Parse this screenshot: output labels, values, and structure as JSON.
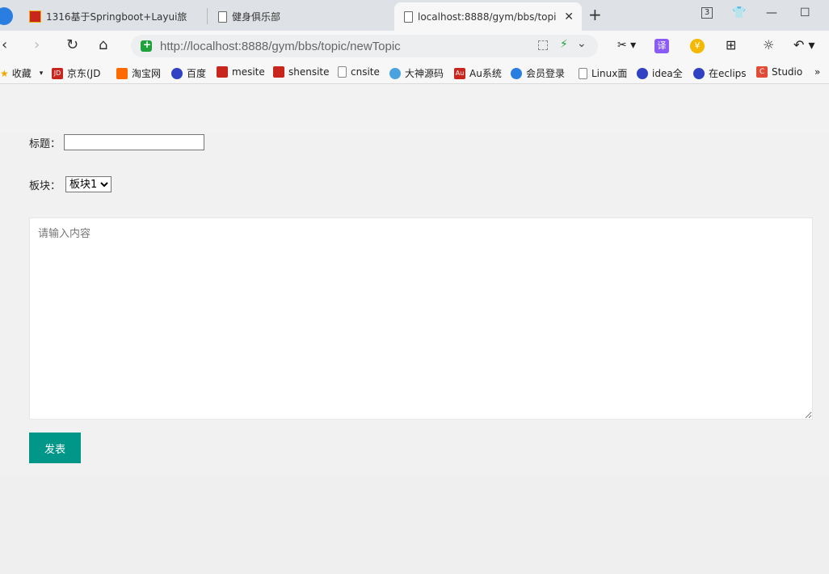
{
  "browser": {
    "tabs": [
      {
        "label": "1316基于Springboot+Layui旅"
      },
      {
        "label": "健身俱乐部"
      },
      {
        "label": "localhost:8888/gym/bbs/topi",
        "close": "✕"
      }
    ],
    "new_tab": "+",
    "win_controls": {
      "badge": "3",
      "shirt": "👕",
      "minimize": "—",
      "maximize": "☐"
    },
    "address": "http://localhost:8888/gym/bbs/topic/newTopic",
    "ext": {
      "translate": "译",
      "coin": "¥"
    }
  },
  "bookmarks": [
    {
      "label": "收藏",
      "color": "#f0a800"
    },
    {
      "label": "京东(JD",
      "color": "#c8251d",
      "text": "JD"
    },
    {
      "label": "淘宝网",
      "color": "#ff6a00"
    },
    {
      "label": "百度",
      "color": "#3042c3"
    },
    {
      "label": "mesite",
      "color": "#c8251d"
    },
    {
      "label": "shensite",
      "color": "#c8251d"
    },
    {
      "label": "cnsite",
      "color": "#888888"
    },
    {
      "label": "大神源码",
      "color": "#4aa3df"
    },
    {
      "label": "Au系统",
      "color": "#c8251d",
      "text": "Au"
    },
    {
      "label": "会员登录",
      "color": "#2a7de1"
    },
    {
      "label": "Linux面",
      "color": "#888888"
    },
    {
      "label": "idea全",
      "color": "#3042c3"
    },
    {
      "label": "在eclips",
      "color": "#3042c3"
    },
    {
      "label": "Studio",
      "color": "#e24b35",
      "text": "C"
    }
  ],
  "bookmarks_more": "»",
  "form": {
    "title_label": "标题：",
    "title_value": "",
    "board_label": "板块：",
    "board_selected": "板块1",
    "content_placeholder": "请输入内容",
    "content_value": "",
    "submit_label": "发表"
  },
  "colors": {
    "primary_button": "#009688"
  }
}
